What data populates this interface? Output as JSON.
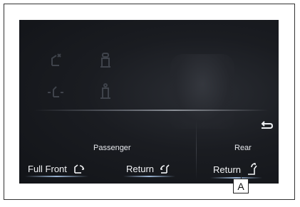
{
  "screen": {
    "passenger_label": "Passenger",
    "rear_label": "Rear",
    "buttons": {
      "full_front": "Full Front",
      "return_passenger": "Return",
      "return_rear": "Return"
    },
    "back_icon": "back-arrow-icon"
  },
  "callout": {
    "letter": "A"
  }
}
